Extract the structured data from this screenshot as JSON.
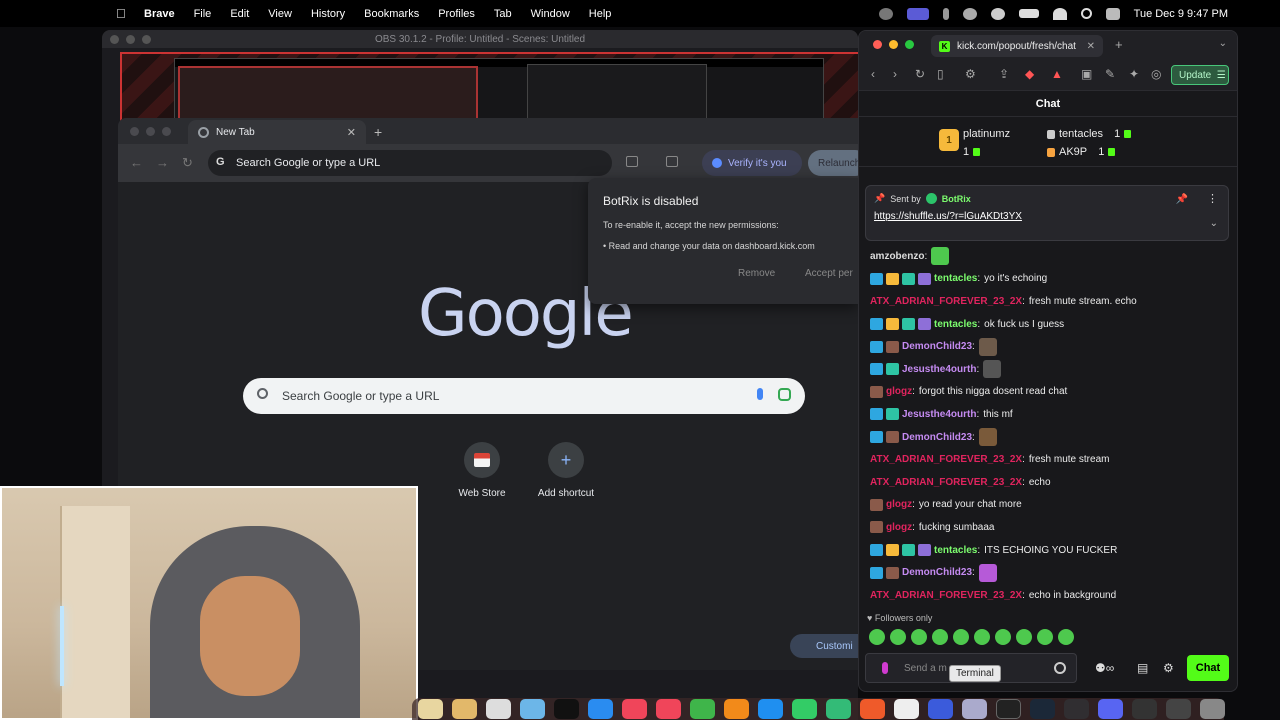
{
  "menubar": {
    "app": "Brave",
    "items": [
      "File",
      "Edit",
      "View",
      "History",
      "Bookmarks",
      "Profiles",
      "Tab",
      "Window",
      "Help"
    ],
    "clock": "Tue Dec 9  9:47 PM"
  },
  "obs": {
    "title": "OBS 30.1.2 - Profile: Untitled - Scenes: Untitled"
  },
  "chrome": {
    "tab_title": "New Tab",
    "omnibox_placeholder": "Search Google or type a URL",
    "verify_label": "Verify it's you",
    "relaunch_label": "Relaunch",
    "google_logo": "Google",
    "search_placeholder": "Search Google or type a URL",
    "shortcuts": [
      "Web Store",
      "Add shortcut"
    ],
    "customize_label": "Customi"
  },
  "botrix": {
    "title": "BotRix is disabled",
    "line1": "To re-enable it, accept the new permissions:",
    "line2": "• Read and change your data on dashboard.kick.com",
    "remove": "Remove",
    "accept": "Accept per"
  },
  "brave": {
    "tab_title": "kick.com/popout/fresh/chat",
    "update_label": "Update",
    "chat_header": "Chat",
    "leaderboard": [
      {
        "rank": "1",
        "name": "platinumz",
        "count": "1"
      },
      {
        "rank": "",
        "name": "tentacles",
        "count": "1"
      },
      {
        "rank": "",
        "name": "AK9P",
        "count": "1"
      }
    ],
    "pinned": {
      "sent_by": "Sent by",
      "bot": "BotRix",
      "link": "https://shuffle.us/?r=lGuAKDt3YX"
    },
    "messages": [
      {
        "user": "amzobenzo",
        "color": "#dcdcdc",
        "text": "",
        "badges": [],
        "emote": "#4ec94e"
      },
      {
        "user": "tentacles",
        "color": "#7cfc6e",
        "text": "yo it's echoing",
        "badges": [
          "#2ea7e0",
          "#f6b93b",
          "#2ec4a4",
          "#8e6fd8"
        ],
        "emote": ""
      },
      {
        "user": "ATX_ADRIAN_FOREVER_23_2X",
        "color": "#e0245e",
        "text": "fresh mute stream. echo",
        "badges": [],
        "emote": ""
      },
      {
        "user": "tentacles",
        "color": "#7cfc6e",
        "text": "ok fuck us I guess",
        "badges": [
          "#2ea7e0",
          "#f6b93b",
          "#2ec4a4",
          "#8e6fd8"
        ],
        "emote": ""
      },
      {
        "user": "DemonChild23",
        "color": "#c58bf2",
        "text": "",
        "badges": [
          "#2ea7e0",
          "#8a5a4a"
        ],
        "emote": "#6d5a4a"
      },
      {
        "user": "Jesusthe4ourth",
        "color": "#c58bf2",
        "text": "",
        "badges": [
          "#2ea7e0",
          "#2ec4a4"
        ],
        "emote": "#555"
      },
      {
        "user": "glogz",
        "color": "#e0245e",
        "text": "forgot this nigga dosent read chat",
        "badges": [
          "#8a5a4a"
        ],
        "emote": ""
      },
      {
        "user": "Jesusthe4ourth",
        "color": "#c58bf2",
        "text": "this mf",
        "badges": [
          "#2ea7e0",
          "#2ec4a4"
        ],
        "emote": ""
      },
      {
        "user": "DemonChild23",
        "color": "#c58bf2",
        "text": "",
        "badges": [
          "#2ea7e0",
          "#8a5a4a"
        ],
        "emote": "#7a5a3a"
      },
      {
        "user": "ATX_ADRIAN_FOREVER_23_2X",
        "color": "#e0245e",
        "text": "fresh mute stream",
        "badges": [],
        "emote": ""
      },
      {
        "user": "ATX_ADRIAN_FOREVER_23_2X",
        "color": "#e0245e",
        "text": "echo",
        "badges": [],
        "emote": ""
      },
      {
        "user": "glogz",
        "color": "#e0245e",
        "text": "yo read your chat more",
        "badges": [
          "#8a5a4a"
        ],
        "emote": ""
      },
      {
        "user": "glogz",
        "color": "#e0245e",
        "text": "fucking sumbaaa",
        "badges": [
          "#8a5a4a"
        ],
        "emote": ""
      },
      {
        "user": "tentacles",
        "color": "#7cfc6e",
        "text": "ITS ECHOING YOU FUCKER",
        "badges": [
          "#2ea7e0",
          "#f6b93b",
          "#2ec4a4",
          "#8e6fd8"
        ],
        "emote": ""
      },
      {
        "user": "DemonChild23",
        "color": "#c58bf2",
        "text": "",
        "badges": [
          "#2ea7e0",
          "#8a5a4a"
        ],
        "emote": "#b65ad8"
      },
      {
        "user": "ATX_ADRIAN_FOREVER_23_2X",
        "color": "#e0245e",
        "text": "echo in background",
        "badges": [],
        "emote": ""
      }
    ],
    "followers_only": "Followers only",
    "input_placeholder": "Send a m",
    "tooltip": "Terminal",
    "chat_button": "Chat"
  },
  "colors": {
    "kick_green": "#53fc18",
    "chat_bg": "#18181b"
  }
}
